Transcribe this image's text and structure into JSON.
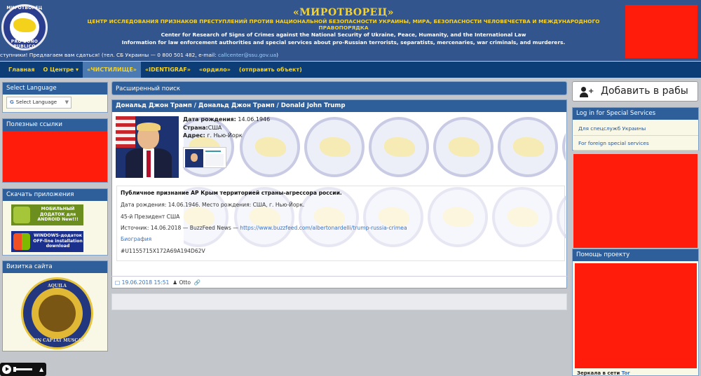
{
  "header": {
    "logo_text_top": "МИРОТВОРЕЦ",
    "logo_text_bottom": "PRO BONO PUBLICO",
    "brand": "«МИРОТВОРЕЦ»",
    "subtitle_ru": "ЦЕНТР ИССЛЕДОВАНИЯ ПРИЗНАКОВ ПРЕСТУПЛЕНИЙ ПРОТИВ НАЦИОНАЛЬНОЙ БЕЗОПАСНОСТИ УКРАИНЫ, МИРА, БЕЗОПАСНОСТИ ЧЕЛОВЕЧЕСТВА И МЕЖДУНАРОДНОГО ПРАВОПОРЯДКА",
    "subtitle_en1": "Center for Research of Signs of Crimes against the National Security of Ukraine, Peace, Humanity, and the International Law",
    "subtitle_en2": "Information for law enforcement authorities and special services about pro-Russian terrorists, separatists, mercenaries, war criminals, and murderers.",
    "marquee_prefix": "ступники! Предлагаем вам сдаться! (тел. СБ Украины — 0 800 501 482, e-mail: ",
    "marquee_email": "callcenter@ssu.gov.ua",
    "marquee_suffix": ")"
  },
  "nav": {
    "items": [
      {
        "label": "Главная"
      },
      {
        "label": "О Центре ▾"
      },
      {
        "label": "«ЧИСТИЛИЩЕ»"
      },
      {
        "label": "«IDENTIGRAF»"
      },
      {
        "label": "«ордило»"
      },
      {
        "label": "(отправить объект)"
      }
    ]
  },
  "left": {
    "language_title": "Select Language",
    "language_select_g": "G",
    "language_select": "Select Language",
    "language_arrow": "▼",
    "links_title": "Полезные ссылки",
    "apps_title": "Скачать приложения",
    "android_label": "МОБИЛЬНЫЙ ДОДАТОК для ANDROID New!!!",
    "windows_label": "WINDOWS-додаток OFF-line installation download",
    "card_title": "Визитка сайта",
    "emblem_top": "AQUILA",
    "emblem_bottom": "NON CAPTAT MUSCAS"
  },
  "center": {
    "search_title": "Расширенный поиск",
    "article_title": "Дональд Джон Трамп / Дональд Джон Трамп / Donald John Trump",
    "birth_label": "Дата рождения:",
    "birth_value": " 14.06.1946",
    "country_label": "Страна:",
    "country_value": "США",
    "address_label": "Адрес:",
    "address_value": " г. Нью-Йорк",
    "accusation": "Публичное признание АР Крым территорией страны-агрессора россии.",
    "details": "Дата рождения: 14.06.1946. Место рождения: США, г. Нью-Йорк.",
    "position": "45-й Президент США",
    "source_prefix": "Источник: 14.06.2018 — BuzzFeed News — ",
    "source_link": "https://www.buzzfeed.com/albertonardelli/trump-russia-crimea",
    "bio_link": "Биография",
    "hash": "#U1155715X172A69A194D62V",
    "date": "19.06.2018 15:51",
    "author": "Otto",
    "calendar_icon": "calendar-icon",
    "user_icon": "user-icon",
    "link_icon": "link-icon"
  },
  "right": {
    "add_button": "Добавить в рабы",
    "special_title": "Log in for Special Services",
    "special_ukraine": "Для спецслужб Украины",
    "special_foreign": "For foreign special services",
    "help_title": "Помощь проекту",
    "mirror_prefix": "Зеркала в сети ",
    "mirror_link": "Tor"
  },
  "player": {
    "play_icon": "play-icon",
    "volume_icon": "volume-icon",
    "up_glyph": "▲"
  },
  "colors": {
    "header_bg": "#33558d",
    "nav_bg": "#0d3d76",
    "nav_text": "#f1d22f",
    "panel_title_bg": "#2f5f9a",
    "panel_bg": "#f9f8e6",
    "redacted": "#ff1c0a"
  }
}
